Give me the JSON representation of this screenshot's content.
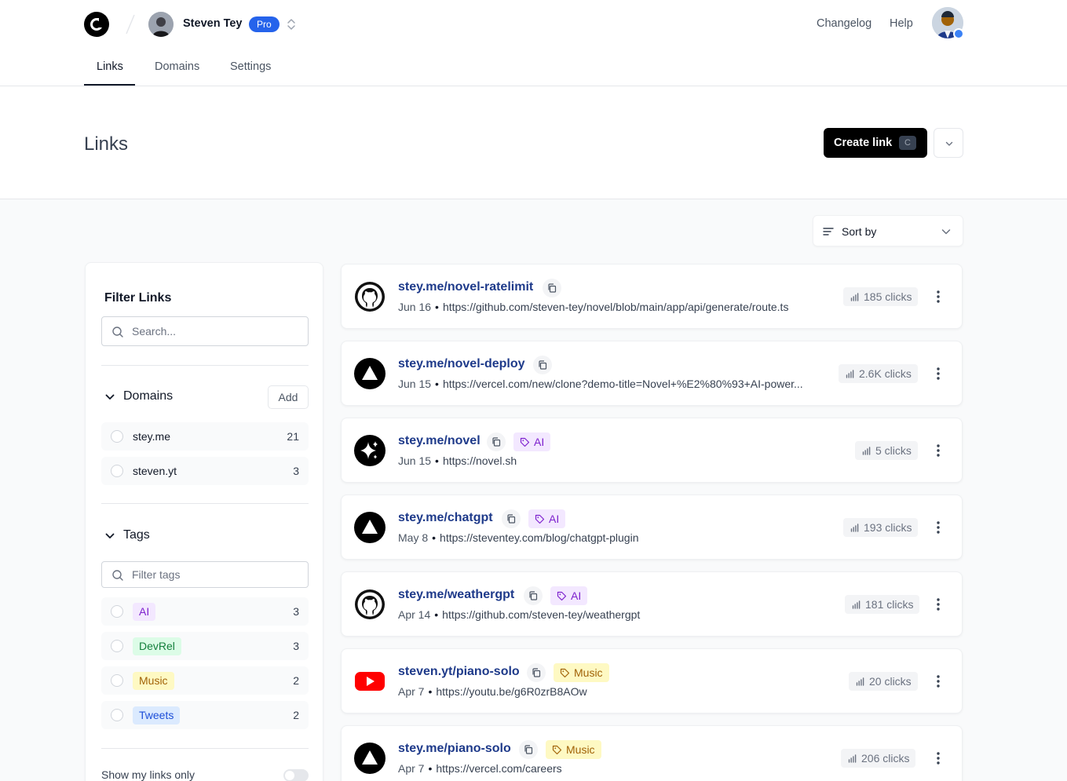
{
  "header": {
    "user_name": "Steven Tey",
    "plan_badge": "Pro",
    "links": [
      "Changelog",
      "Help"
    ],
    "tabs": [
      "Links",
      "Domains",
      "Settings"
    ],
    "active_tab": "Links"
  },
  "page": {
    "title": "Links",
    "create_button": "Create link",
    "create_shortcut": "C",
    "sort_label": "Sort by"
  },
  "filter": {
    "title": "Filter Links",
    "search_placeholder": "Search...",
    "domains_label": "Domains",
    "add_label": "Add",
    "domains": [
      {
        "name": "stey.me",
        "count": "21"
      },
      {
        "name": "steven.yt",
        "count": "3"
      }
    ],
    "tags_label": "Tags",
    "tags_placeholder": "Filter tags",
    "tags": [
      {
        "name": "AI",
        "count": "3",
        "color": "#7e22ce"
      },
      {
        "name": "DevRel",
        "count": "3",
        "color": "#15803d"
      },
      {
        "name": "Music",
        "count": "2",
        "color": "#a16207"
      },
      {
        "name": "Tweets",
        "count": "2",
        "color": "#1d4ed8"
      }
    ],
    "show_mine_label": "Show my links only"
  },
  "links": [
    {
      "short": "stey.me/novel-ratelimit",
      "tag": "",
      "date": "Jun 16",
      "url": "https://github.com/steven-tey/novel/blob/main/app/api/generate/route.ts",
      "clicks": "185 clicks",
      "icon": "github-icon"
    },
    {
      "short": "stey.me/novel-deploy",
      "tag": "",
      "date": "Jun 15",
      "url": "https://vercel.com/new/clone?demo-title=Novel+%E2%80%93+AI-power...",
      "clicks": "2.6K clicks",
      "icon": "vercel-icon"
    },
    {
      "short": "stey.me/novel",
      "tag": "AI",
      "date": "Jun 15",
      "url": "https://novel.sh",
      "clicks": "5 clicks",
      "icon": "novel-icon"
    },
    {
      "short": "stey.me/chatgpt",
      "tag": "AI",
      "date": "May 8",
      "url": "https://steventey.com/blog/chatgpt-plugin",
      "clicks": "193 clicks",
      "icon": "vercel-icon"
    },
    {
      "short": "stey.me/weathergpt",
      "tag": "AI",
      "date": "Apr 14",
      "url": "https://github.com/steven-tey/weathergpt",
      "clicks": "181 clicks",
      "icon": "github-icon"
    },
    {
      "short": "steven.yt/piano-solo",
      "tag": "Music",
      "date": "Apr 7",
      "url": "https://youtu.be/g6R0zrB8AOw",
      "clicks": "20 clicks",
      "icon": "youtube-icon"
    },
    {
      "short": "stey.me/piano-solo",
      "tag": "Music",
      "date": "Apr 7",
      "url": "https://vercel.com/careers",
      "clicks": "206 clicks",
      "icon": "vercel-icon"
    }
  ]
}
